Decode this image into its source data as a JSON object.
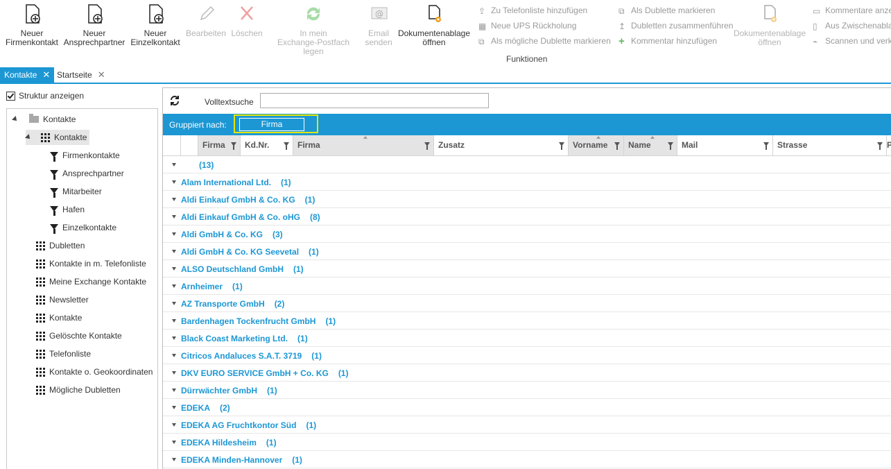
{
  "ribbon": {
    "buttons": [
      {
        "label1": "Neuer",
        "label2": "Firmenkontakt",
        "icon": "new-company-contact-icon",
        "disabled": false
      },
      {
        "label1": "Neuer",
        "label2": "Ansprechpartner",
        "icon": "new-contact-person-icon",
        "disabled": false
      },
      {
        "label1": "Neuer",
        "label2": "Einzelkontakt",
        "icon": "new-single-contact-icon",
        "disabled": false
      },
      {
        "label1": "Bearbeiten",
        "label2": "",
        "icon": "pencil-icon",
        "disabled": true
      },
      {
        "label1": "Löschen",
        "label2": "",
        "icon": "delete-x-icon",
        "disabled": true
      },
      {
        "label1": "In mein",
        "label2": "Exchange-Postfach legen",
        "icon": "sync-icon",
        "disabled": true
      },
      {
        "label1": "Email",
        "label2": "senden",
        "icon": "email-icon",
        "disabled": true
      },
      {
        "label1": "Dokumentenablage",
        "label2": "öffnen",
        "icon": "document-storage-icon",
        "disabled": false
      },
      {
        "label1": "Dokumentenablage",
        "label2": "öffnen",
        "icon": "document-storage-icon",
        "disabled": true
      }
    ],
    "small_actions": [
      {
        "label": "Zu Telefonliste hinzufügen",
        "icon": "phone-list-add-icon"
      },
      {
        "label": "Neue UPS Rückholung",
        "icon": "ups-icon"
      },
      {
        "label": "Als mögliche Dublette markieren",
        "icon": "mark-possible-duplicate-icon"
      },
      {
        "label": "Als Dublette markieren",
        "icon": "mark-duplicate-icon"
      },
      {
        "label": "Dubletten zusammenführen",
        "icon": "merge-duplicates-icon"
      },
      {
        "label": "Kommentar hinzufügen",
        "icon": "plus-icon"
      },
      {
        "label": "Kommentare anze",
        "icon": "comments-icon"
      },
      {
        "label": "Aus Zwischenabla",
        "icon": "clipboard-icon"
      },
      {
        "label": "Scannen und verk",
        "icon": "scan-icon"
      }
    ],
    "group_label": "Funktionen"
  },
  "tabs": [
    {
      "label": "Kontakte",
      "active": true
    },
    {
      "label": "Startseite",
      "active": false
    }
  ],
  "left": {
    "checkbox_label": "Struktur anzeigen",
    "tree": [
      {
        "label": "Kontakte",
        "icon": "folder-icon",
        "indent": 0,
        "expander": true,
        "selected": false
      },
      {
        "label": "Kontakte",
        "icon": "grid-icon",
        "indent": 1,
        "expander": true,
        "selected": true
      },
      {
        "label": "Firmenkontakte",
        "icon": "filter-icon",
        "indent": 2,
        "expander": false,
        "selected": false
      },
      {
        "label": "Ansprechpartner",
        "icon": "filter-icon",
        "indent": 2,
        "expander": false,
        "selected": false
      },
      {
        "label": "Mitarbeiter",
        "icon": "filter-icon",
        "indent": 2,
        "expander": false,
        "selected": false
      },
      {
        "label": "Hafen",
        "icon": "filter-icon",
        "indent": 2,
        "expander": false,
        "selected": false
      },
      {
        "label": "Einzelkontakte",
        "icon": "filter-icon",
        "indent": 2,
        "expander": false,
        "selected": false
      },
      {
        "label": "Dubletten",
        "icon": "grid-icon",
        "indent": 1,
        "expander": false,
        "selected": false
      },
      {
        "label": "Kontakte in m. Telefonliste",
        "icon": "grid-icon",
        "indent": 1,
        "expander": false,
        "selected": false
      },
      {
        "label": "Meine Exchange Kontakte",
        "icon": "grid-icon",
        "indent": 1,
        "expander": false,
        "selected": false
      },
      {
        "label": "Newsletter",
        "icon": "grid-icon",
        "indent": 1,
        "expander": false,
        "selected": false
      },
      {
        "label": "Kontakte",
        "icon": "grid-icon",
        "indent": 1,
        "expander": false,
        "selected": false
      },
      {
        "label": "Gelöschte Kontakte",
        "icon": "grid-icon",
        "indent": 1,
        "expander": false,
        "selected": false
      },
      {
        "label": "Telefonliste",
        "icon": "grid-icon",
        "indent": 1,
        "expander": false,
        "selected": false
      },
      {
        "label": "Kontakte o. Geokoordinaten",
        "icon": "grid-icon",
        "indent": 1,
        "expander": false,
        "selected": false
      },
      {
        "label": "Mögliche Dubletten",
        "icon": "grid-icon",
        "indent": 1,
        "expander": false,
        "selected": false
      }
    ]
  },
  "main": {
    "search_label": "Volltextsuche",
    "search_value": "",
    "grouped_by_label": "Gruppiert nach:",
    "group_chip": "Firma",
    "columns": [
      {
        "label": "",
        "grouped": false,
        "filter": false,
        "sort": false
      },
      {
        "label": "",
        "grouped": false,
        "filter": false,
        "sort": false
      },
      {
        "label": "Firma",
        "grouped": true,
        "filter": true,
        "sort": false
      },
      {
        "label": "Kd.Nr.",
        "grouped": false,
        "filter": true,
        "sort": false
      },
      {
        "label": "Firma",
        "grouped": true,
        "filter": true,
        "sort": true
      },
      {
        "label": "Zusatz",
        "grouped": false,
        "filter": true,
        "sort": false
      },
      {
        "label": "Vorname",
        "grouped": true,
        "filter": true,
        "sort": true
      },
      {
        "label": "Name",
        "grouped": true,
        "filter": true,
        "sort": true
      },
      {
        "label": "Mail",
        "grouped": false,
        "filter": true,
        "sort": false
      },
      {
        "label": "Strasse",
        "grouped": false,
        "filter": true,
        "sort": false
      },
      {
        "label": "P",
        "grouped": false,
        "filter": false,
        "sort": false
      }
    ],
    "groups": [
      {
        "name": "",
        "count": "(13)"
      },
      {
        "name": "Alam International Ltd.",
        "count": "(1)"
      },
      {
        "name": "Aldi Einkauf GmbH & Co. KG",
        "count": "(1)"
      },
      {
        "name": "Aldi Einkauf GmbH & Co. oHG",
        "count": "(8)"
      },
      {
        "name": "Aldi GmbH & Co. KG",
        "count": "(3)"
      },
      {
        "name": "Aldi GmbH & Co. KG Seevetal",
        "count": "(1)"
      },
      {
        "name": "ALSO Deutschland GmbH",
        "count": "(1)"
      },
      {
        "name": "Arnheimer",
        "count": "(1)"
      },
      {
        "name": "AZ Transporte GmbH",
        "count": "(2)"
      },
      {
        "name": "Bardenhagen Tockenfrucht GmbH",
        "count": "(1)"
      },
      {
        "name": "Black Coast Marketing Ltd.",
        "count": "(1)"
      },
      {
        "name": "Citricos Andaluces S.A.T. 3719",
        "count": "(1)"
      },
      {
        "name": "DKV EURO SERVICE GmbH + Co. KG",
        "count": "(1)"
      },
      {
        "name": "Dürrwächter GmbH",
        "count": "(1)"
      },
      {
        "name": "EDEKA",
        "count": "(2)"
      },
      {
        "name": "EDEKA AG Fruchtkontor Süd",
        "count": "(1)"
      },
      {
        "name": "EDEKA Hildesheim",
        "count": "(1)"
      },
      {
        "name": "EDEKA Minden-Hannover",
        "count": "(1)"
      }
    ]
  },
  "colors": {
    "accent": "#1c97d4",
    "highlight": "#e5e500"
  }
}
